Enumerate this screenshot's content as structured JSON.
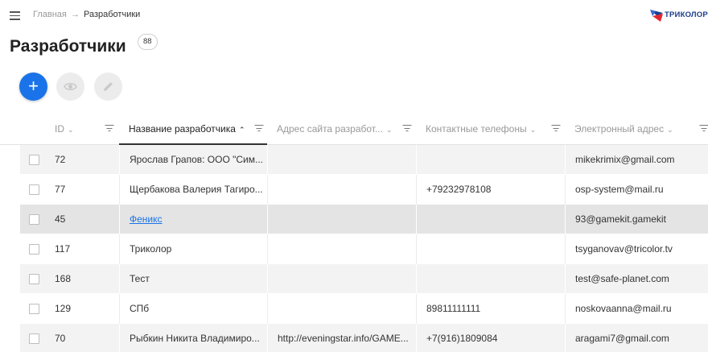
{
  "breadcrumb": {
    "home": "Главная",
    "separator": "→",
    "current": "Разработчики"
  },
  "logo": {
    "text": "ТРИКОЛОР"
  },
  "page": {
    "title": "Разработчики",
    "count": "88"
  },
  "toolbar": {
    "add_label": "+"
  },
  "table": {
    "columns": [
      {
        "label": "ID",
        "sort": "⌄"
      },
      {
        "label": "Название разработчика",
        "sort": "⌃"
      },
      {
        "label": "Адрес сайта разработ...",
        "sort": "⌄"
      },
      {
        "label": "Контактные телефоны",
        "sort": "⌄"
      },
      {
        "label": "Электронный адрес",
        "sort": "⌄"
      }
    ],
    "rows": [
      {
        "id": "72",
        "name": "Ярослав Грапов: ООО \"Сим...",
        "site": "",
        "phone": "",
        "email": "mikekrimix@gmail.com"
      },
      {
        "id": "77",
        "name": "Щербакова Валерия Тагиро...",
        "site": "",
        "phone": "+79232978108",
        "email": "osp-system@mail.ru"
      },
      {
        "id": "45",
        "name": "Феникс",
        "site": "",
        "phone": "",
        "email": "93@gamekit.gamekit"
      },
      {
        "id": "117",
        "name": "Триколор",
        "site": "",
        "phone": "",
        "email": "tsyganovav@tricolor.tv"
      },
      {
        "id": "168",
        "name": "Тест",
        "site": "",
        "phone": "",
        "email": "test@safe-planet.com"
      },
      {
        "id": "129",
        "name": "СПб",
        "site": "",
        "phone": "89811111111",
        "email": "noskovaanna@mail.ru"
      },
      {
        "id": "70",
        "name": "Рыбкин Никита Владимиро...",
        "site": "http://eveningstar.info/GAME...",
        "phone": "+7(916)1809084",
        "email": "aragami7@gmail.com"
      }
    ]
  },
  "colors": {
    "accent": "#1a73e8",
    "logo_blue": "#1d3e8c",
    "logo_red": "#e3262e"
  }
}
